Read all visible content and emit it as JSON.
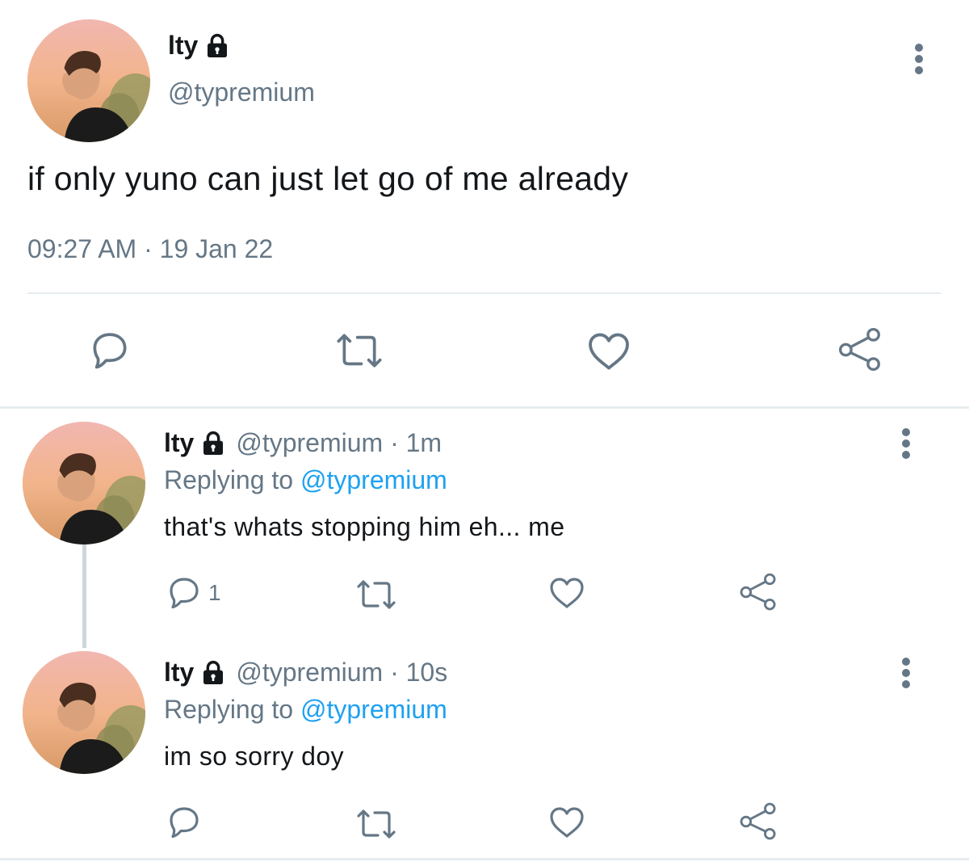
{
  "colors": {
    "muted": "#657786",
    "link": "#1da1f2",
    "text": "#14171a",
    "divider": "#e6ecf0"
  },
  "main_tweet": {
    "name": "lty",
    "handle": "@typremium",
    "lock_icon": "lock-icon",
    "text": "if only yuno can just let go of me already",
    "timestamp": "09:27 AM · 19 Jan 22",
    "actions": [
      "reply-icon",
      "retweet-icon",
      "like-icon",
      "share-icon"
    ]
  },
  "replies": [
    {
      "name": "lty",
      "handle_time": "@typremium · 1m",
      "replying_prefix": "Replying to",
      "replying_to": "@typremium",
      "text": "that's whats stopping him eh... me",
      "reply_count": "1"
    },
    {
      "name": "lty",
      "handle_time": "@typremium · 10s",
      "replying_prefix": "Replying to",
      "replying_to": "@typremium",
      "text": "im so sorry doy",
      "reply_count": ""
    }
  ]
}
